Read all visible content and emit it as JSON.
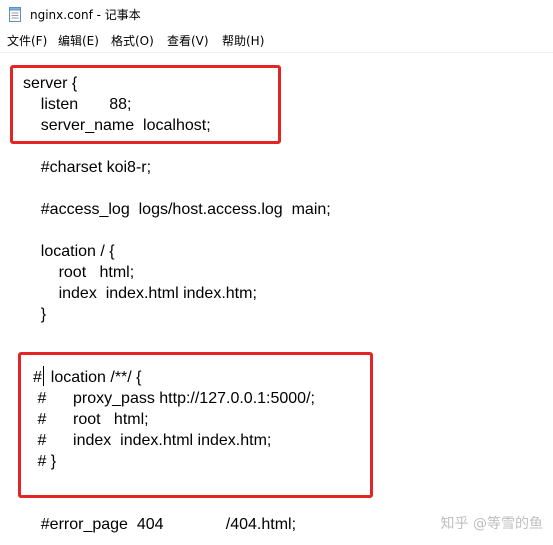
{
  "window": {
    "title": "nginx.conf - 记事本",
    "icon": "notepad-icon"
  },
  "menu": {
    "items": [
      {
        "label": "文件(F)"
      },
      {
        "label": "编辑(E)"
      },
      {
        "label": "格式(O)"
      },
      {
        "label": "查看(V)"
      },
      {
        "label": "帮助(H)"
      }
    ]
  },
  "editor": {
    "lines": [
      "server {",
      "    listen       88;",
      "    server_name  localhost;",
      "    #charset koi8-r;",
      "    #access_log  logs/host.access.log  main;",
      "    location / {",
      "        root   html;",
      "        index  index.html index.htm;",
      "    }",
      "#  location /**/ {",
      " #      proxy_pass http://127.0.0.1:5000/;",
      " #      root   html;",
      " #      index  index.html index.htm;",
      " # }",
      "    #error_page  404              /404.html;"
    ]
  },
  "annotations": {
    "highlight_color": "#e32525"
  },
  "watermark": {
    "text": "知乎 @等雪的鱼"
  }
}
